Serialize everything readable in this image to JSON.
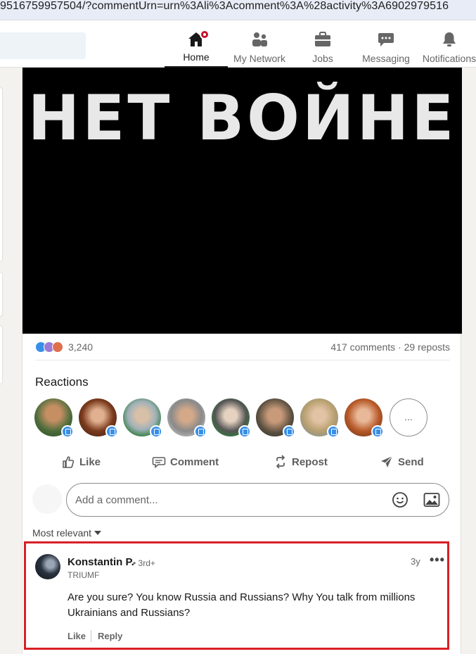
{
  "browser": {
    "url": "9516759957504/?commentUrn=urn%3Ali%3Acomment%3A%28activity%3A6902979516"
  },
  "nav": {
    "items": [
      {
        "label": "Home",
        "icon": "home-icon",
        "active": true
      },
      {
        "label": "My Network",
        "icon": "network-icon"
      },
      {
        "label": "Jobs",
        "icon": "briefcase-icon"
      },
      {
        "label": "Messaging",
        "icon": "messaging-icon"
      },
      {
        "label": "Notifications",
        "icon": "bell-icon"
      }
    ]
  },
  "post": {
    "video_text": "НЕТ ВОЙНЕ",
    "reaction_count": "3,240",
    "comments_reposts": "417 comments · 29 reposts",
    "reactions_title": "Reactions",
    "more_reactors": "...",
    "actions": {
      "like": "Like",
      "comment": "Comment",
      "repost": "Repost",
      "send": "Send"
    },
    "comment_placeholder": "Add a comment...",
    "sort_label": "Most relevant"
  },
  "comment": {
    "author": "Konstantin P.",
    "degree": "• 3rd+",
    "org": "TRIUMF",
    "time": "3y",
    "more": "•••",
    "text": "Are you sure? You know Russia and Russians? Why You talk from millions Ukrainians and Russians?",
    "like_label": "Like",
    "reply_label": "Reply"
  },
  "colors": {
    "accent_blue": "#0a66c2",
    "like_blue": "#378fe9",
    "notification_red": "#cb112d",
    "highlight_red": "#d81f26"
  }
}
